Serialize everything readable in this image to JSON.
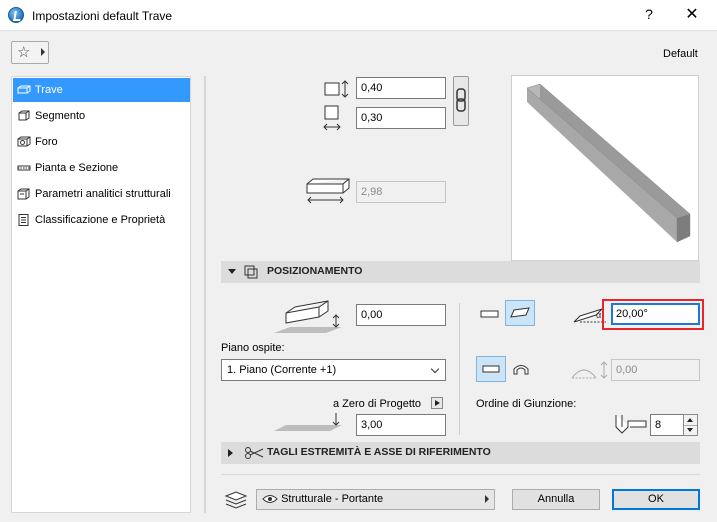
{
  "window": {
    "title": "Impostazioni default Trave",
    "help": "?",
    "close": "✕"
  },
  "toolbar": {
    "default_label": "Default"
  },
  "nav": {
    "items": [
      {
        "label": "Trave",
        "icon": "beam-icon"
      },
      {
        "label": "Segmento",
        "icon": "segment-icon"
      },
      {
        "label": "Foro",
        "icon": "hole-icon"
      },
      {
        "label": "Pianta e Sezione",
        "icon": "plan-section-icon"
      },
      {
        "label": "Parametri analitici strutturali",
        "icon": "structural-analysis-icon"
      },
      {
        "label": "Classificazione e Proprietà",
        "icon": "classification-icon"
      }
    ]
  },
  "geometry": {
    "height": "0,40",
    "width": "0,30",
    "length": "2,98"
  },
  "positioning": {
    "section_title": "POSIZIONAMENTO",
    "offset": "0,00",
    "host_story_label": "Piano ospite:",
    "host_story_value": "1. Piano (Corrente +1)",
    "zero_label": "a Zero di Progetto",
    "zero_value": "3,00",
    "slope_angle": "20,00°",
    "arc_offset": "0,00",
    "junction_order_label": "Ordine di Giunzione:",
    "junction_order_value": "8"
  },
  "section2": {
    "title": "TAGLI ESTREMITÀ E ASSE DI RIFERIMENTO"
  },
  "footer": {
    "layer_label": "Strutturale - Portante",
    "cancel": "Annulla",
    "ok": "OK"
  }
}
